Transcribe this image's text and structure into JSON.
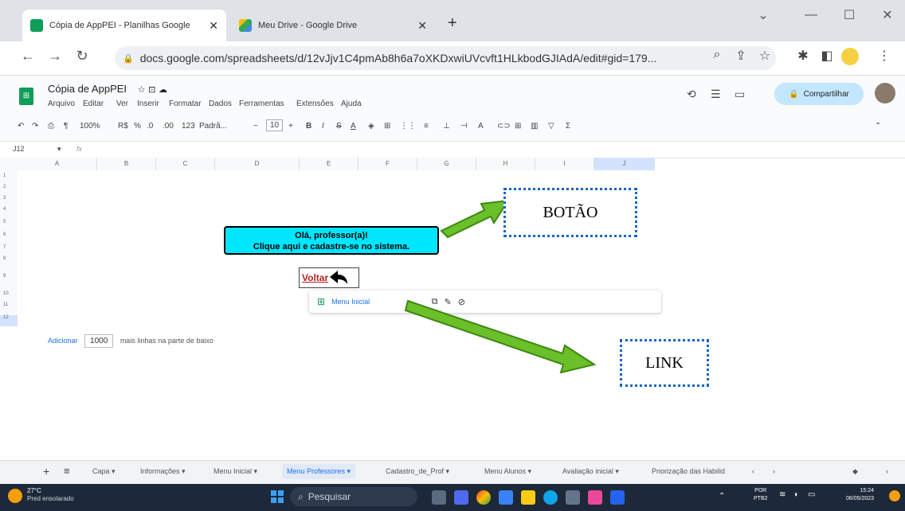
{
  "browser": {
    "tabs": [
      {
        "title": "Cópia de AppPEI - Planilhas Google",
        "close": "✕",
        "active": true
      },
      {
        "title": "Meu Drive - Google Drive",
        "close": "✕",
        "active": false
      }
    ],
    "new_tab": "+",
    "url": "docs.google.com/spreadsheets/d/12vJjv1C4pmAb8h6a7oXKDxwiUVcvft1HLkbodGJIAdA/edit#gid=179..."
  },
  "sheets": {
    "doc_title": "Cópia de AppPEI",
    "menu": [
      "Arquivo",
      "Editar",
      "Ver",
      "Inserir",
      "Formatar",
      "Dados",
      "Ferramentas",
      "Extensões",
      "Ajuda"
    ],
    "share_label": "Compartilhar",
    "toolbar": {
      "zoom": "100%",
      "currency": "R$",
      "percent": "%",
      "dec_less": ".0",
      "dec_more": ".00",
      "number_fmt": "123",
      "font": "Padrã...",
      "font_size": "10",
      "bold": "B",
      "italic": "I"
    },
    "cell_ref": "J12",
    "fx": "fx",
    "columns": [
      "A",
      "B",
      "C",
      "D",
      "E",
      "F",
      "G",
      "H",
      "I",
      "J"
    ],
    "rows": [
      "1",
      "2",
      "3",
      "4",
      "5",
      "6",
      "7",
      "8",
      "9",
      "10",
      "11",
      "12"
    ]
  },
  "content": {
    "cta_line1": "Olá, professor(a)!",
    "cta_line2": "Clique aqui e cadastre-se no sistema.",
    "voltar": "Voltar",
    "popup_link": "Menu Inicial"
  },
  "annotations": {
    "botao": "BOTÃO",
    "link": "LINK",
    "arrow_color": "#6abf2a"
  },
  "add_rows": {
    "button": "Adicionar",
    "count": "1000",
    "suffix": "mais linhas na parte de baixo"
  },
  "sheet_tabs": [
    "Capa",
    "Informações",
    "Menu Inicial",
    "Menu Professores",
    "Cadastro_de_Prof",
    "Menu Alunos",
    "Avaliação inicial",
    "Priorização das Habilid"
  ],
  "active_sheet": "Menu Professores",
  "taskbar": {
    "weather_temp": "27°C",
    "weather_desc": "Pred ensolarado",
    "search": "Pesquisar",
    "lang": "POR",
    "lang2": "PTB2",
    "time": "15:24",
    "date": "06/05/2023"
  }
}
